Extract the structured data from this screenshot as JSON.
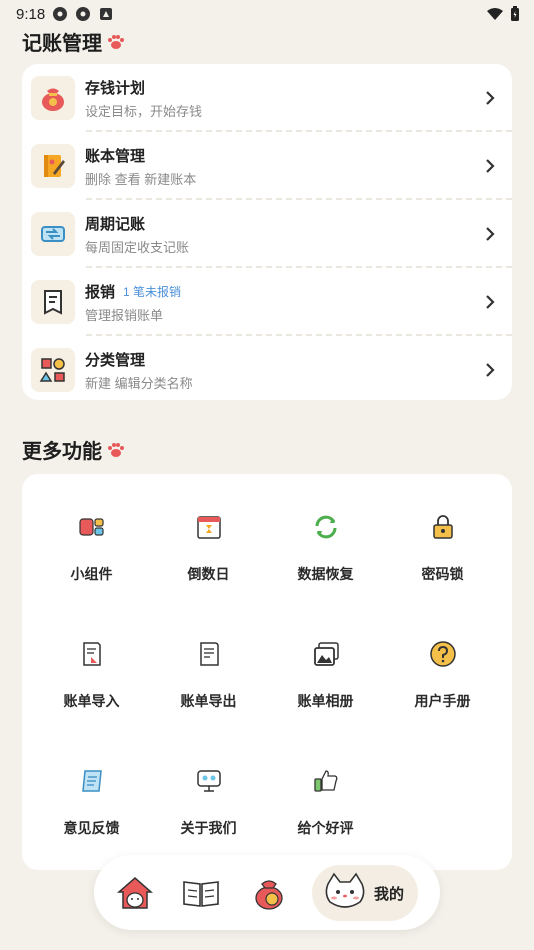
{
  "status_bar": {
    "time": "9:18",
    "icons": [
      "app-icon",
      "app-icon",
      "notification-icon",
      "wifi-icon",
      "battery-icon"
    ]
  },
  "bookkeeping": {
    "title": "记账管理",
    "items": [
      {
        "title": "存钱计划",
        "subtitle": "设定目标，开始存钱",
        "icon": "money-bag-icon"
      },
      {
        "title": "账本管理",
        "subtitle": "删除 查看 新建账本",
        "icon": "ledger-book-icon"
      },
      {
        "title": "周期记账",
        "subtitle": "每周固定收支记账",
        "icon": "cycle-icon"
      },
      {
        "title": "报销",
        "badge": "1 笔未报销",
        "subtitle": "管理报销账单",
        "icon": "receipt-icon"
      },
      {
        "title": "分类管理",
        "subtitle": "新建 编辑分类名称",
        "icon": "category-shapes-icon"
      }
    ]
  },
  "more": {
    "title": "更多功能",
    "items": [
      {
        "label": "小组件",
        "icon": "widget-icon"
      },
      {
        "label": "倒数日",
        "icon": "calendar-hourglass-icon"
      },
      {
        "label": "数据恢复",
        "icon": "sync-icon"
      },
      {
        "label": "密码锁",
        "icon": "lock-icon"
      },
      {
        "label": "账单导入",
        "icon": "bill-import-icon"
      },
      {
        "label": "账单导出",
        "icon": "bill-export-icon"
      },
      {
        "label": "账单相册",
        "icon": "photo-album-icon"
      },
      {
        "label": "用户手册",
        "icon": "help-manual-icon"
      },
      {
        "label": "意见反馈",
        "icon": "feedback-scroll-icon"
      },
      {
        "label": "关于我们",
        "icon": "about-us-icon"
      },
      {
        "label": "给个好评",
        "icon": "thumbs-up-icon"
      }
    ]
  },
  "tabbar": {
    "tabs": [
      {
        "icon": "house-cat-icon"
      },
      {
        "icon": "open-book-icon"
      },
      {
        "icon": "money-bag-icon"
      },
      {
        "icon": "cat-face-icon",
        "label": "我的"
      }
    ]
  },
  "colors": {
    "background": "#f4f1ea",
    "card": "#ffffff",
    "accent_red": "#e85a5a",
    "badge_blue": "#4a90d9"
  }
}
